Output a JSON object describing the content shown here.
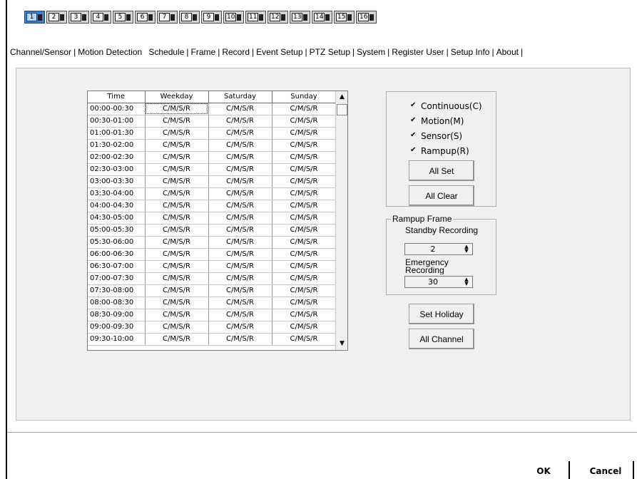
{
  "channels": [
    "1",
    "2",
    "3",
    "4",
    "5",
    "6",
    "7",
    "8",
    "9",
    "10",
    "11",
    "12",
    "13",
    "14",
    "15",
    "16"
  ],
  "tabs": [
    "Channel/Sensor",
    "Motion Detection",
    "Schedule",
    "Frame",
    "Record",
    "Event Setup",
    "PTZ Setup",
    "System",
    "Register User",
    "Setup Info",
    "About"
  ],
  "schedule": {
    "columns": [
      "Time",
      "Weekday",
      "Saturday",
      "Sunday"
    ],
    "rows": [
      [
        "00:00-00:30",
        "C/M/S/R",
        "C/M/S/R",
        "C/M/S/R"
      ],
      [
        "00:30-01:00",
        "C/M/S/R",
        "C/M/S/R",
        "C/M/S/R"
      ],
      [
        "01:00-01:30",
        "C/M/S/R",
        "C/M/S/R",
        "C/M/S/R"
      ],
      [
        "01:30-02:00",
        "C/M/S/R",
        "C/M/S/R",
        "C/M/S/R"
      ],
      [
        "02:00-02:30",
        "C/M/S/R",
        "C/M/S/R",
        "C/M/S/R"
      ],
      [
        "02:30-03:00",
        "C/M/S/R",
        "C/M/S/R",
        "C/M/S/R"
      ],
      [
        "03:00-03:30",
        "C/M/S/R",
        "C/M/S/R",
        "C/M/S/R"
      ],
      [
        "03:30-04:00",
        "C/M/S/R",
        "C/M/S/R",
        "C/M/S/R"
      ],
      [
        "04:00-04:30",
        "C/M/S/R",
        "C/M/S/R",
        "C/M/S/R"
      ],
      [
        "04:30-05:00",
        "C/M/S/R",
        "C/M/S/R",
        "C/M/S/R"
      ],
      [
        "05:00-05:30",
        "C/M/S/R",
        "C/M/S/R",
        "C/M/S/R"
      ],
      [
        "05:30-06:00",
        "C/M/S/R",
        "C/M/S/R",
        "C/M/S/R"
      ],
      [
        "06:00-06:30",
        "C/M/S/R",
        "C/M/S/R",
        "C/M/S/R"
      ],
      [
        "06:30-07:00",
        "C/M/S/R",
        "C/M/S/R",
        "C/M/S/R"
      ],
      [
        "07:00-07:30",
        "C/M/S/R",
        "C/M/S/R",
        "C/M/S/R"
      ],
      [
        "07:30-08:00",
        "C/M/S/R",
        "C/M/S/R",
        "C/M/S/R"
      ],
      [
        "08:00-08:30",
        "C/M/S/R",
        "C/M/S/R",
        "C/M/S/R"
      ],
      [
        "08:30-09:00",
        "C/M/S/R",
        "C/M/S/R",
        "C/M/S/R"
      ],
      [
        "09:00-09:30",
        "C/M/S/R",
        "C/M/S/R",
        "C/M/S/R"
      ],
      [
        "09:30-10:00",
        "C/M/S/R",
        "C/M/S/R",
        "C/M/S/R"
      ]
    ]
  },
  "options": {
    "continuous": "Continuous(C)",
    "motion": "Motion(M)",
    "sensor": "Sensor(S)",
    "rampup": "Rampup(R)",
    "all_set": "All Set",
    "all_clear": "All Clear"
  },
  "rampup": {
    "title": "Rampup Frame",
    "standby_label": "Standby Recording",
    "standby_value": "2",
    "emergency_label": "Emergency Recording",
    "emergency_value": "30"
  },
  "actions": {
    "set_holiday": "Set Holiday",
    "all_channel": "All Channel",
    "ok": "OK",
    "cancel": "Cancel"
  },
  "colors": {
    "active_channel": "#3f7fd7",
    "panel_bg": "#f0f0f0"
  }
}
